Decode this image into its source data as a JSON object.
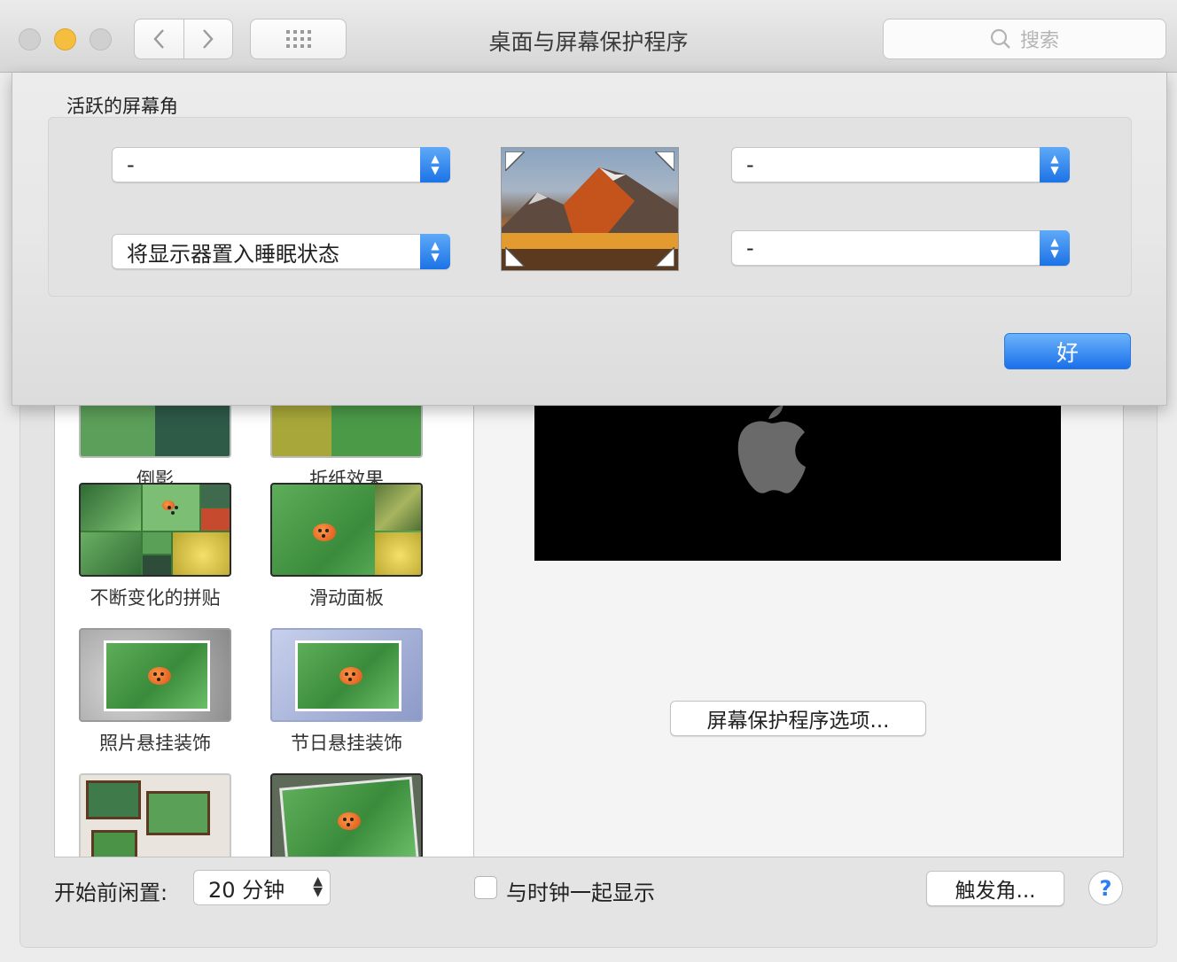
{
  "window": {
    "title": "桌面与屏幕保护程序"
  },
  "toolbar": {
    "back_icon": "chevron-left-icon",
    "forward_icon": "chevron-right-icon",
    "grid_icon": "grid-icon",
    "search_placeholder": "搜索"
  },
  "screensavers": [
    {
      "label": "倒影"
    },
    {
      "label": "折纸效果"
    },
    {
      "label": "不断变化的拼贴"
    },
    {
      "label": "滑动面板"
    },
    {
      "label": "照片悬挂装饰"
    },
    {
      "label": "节日悬挂装饰"
    }
  ],
  "preview": {
    "options_label": "屏幕保护程序选项..."
  },
  "bottom": {
    "idle_label": "开始前闲置:",
    "idle_value": "20 分钟",
    "clock_label": "与时钟一起显示",
    "clock_checked": false,
    "hot_corners_label": "触发角...",
    "help_label": "?"
  },
  "sheet": {
    "title": "活跃的屏幕角",
    "top_left": "-",
    "bottom_left": "将显示器置入睡眠状态",
    "top_right": "-",
    "bottom_right": "-",
    "ok_label": "好"
  },
  "colors": {
    "accent": "#1a70ea",
    "window_bg": "#ececec"
  }
}
